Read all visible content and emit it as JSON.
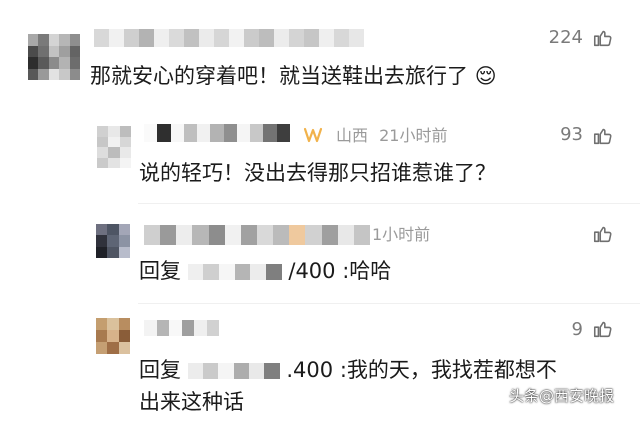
{
  "comments": [
    {
      "like_count": "224",
      "text": "那就安心的穿着吧！就当送鞋出去旅行了",
      "emoji": "😌",
      "replies": [
        {
          "location": "山西",
          "time": "21小时前",
          "like_count": "93",
          "text": "说的轻巧！没出去得那只招谁惹谁了？"
        },
        {
          "time_partial": "1小时前",
          "like_count": "",
          "reply_prefix": "回复",
          "reply_suffix": "/400",
          "reply_text": ":哈哈"
        },
        {
          "like_count": "9",
          "reply_prefix": "回复",
          "reply_suffix": ".400",
          "reply_text": ":我的天，我找茬都想不",
          "reply_text_line2": "出来这种话"
        }
      ]
    }
  ],
  "watermark": "头条@西安晚报",
  "colors": {
    "meta": "#9a9a9a",
    "like": "#7a7a7a",
    "badge": "#f1b24b",
    "text": "#1b1b1b"
  },
  "icons": {
    "like": "thumbs-up-icon",
    "badge": "vip-badge-icon"
  }
}
